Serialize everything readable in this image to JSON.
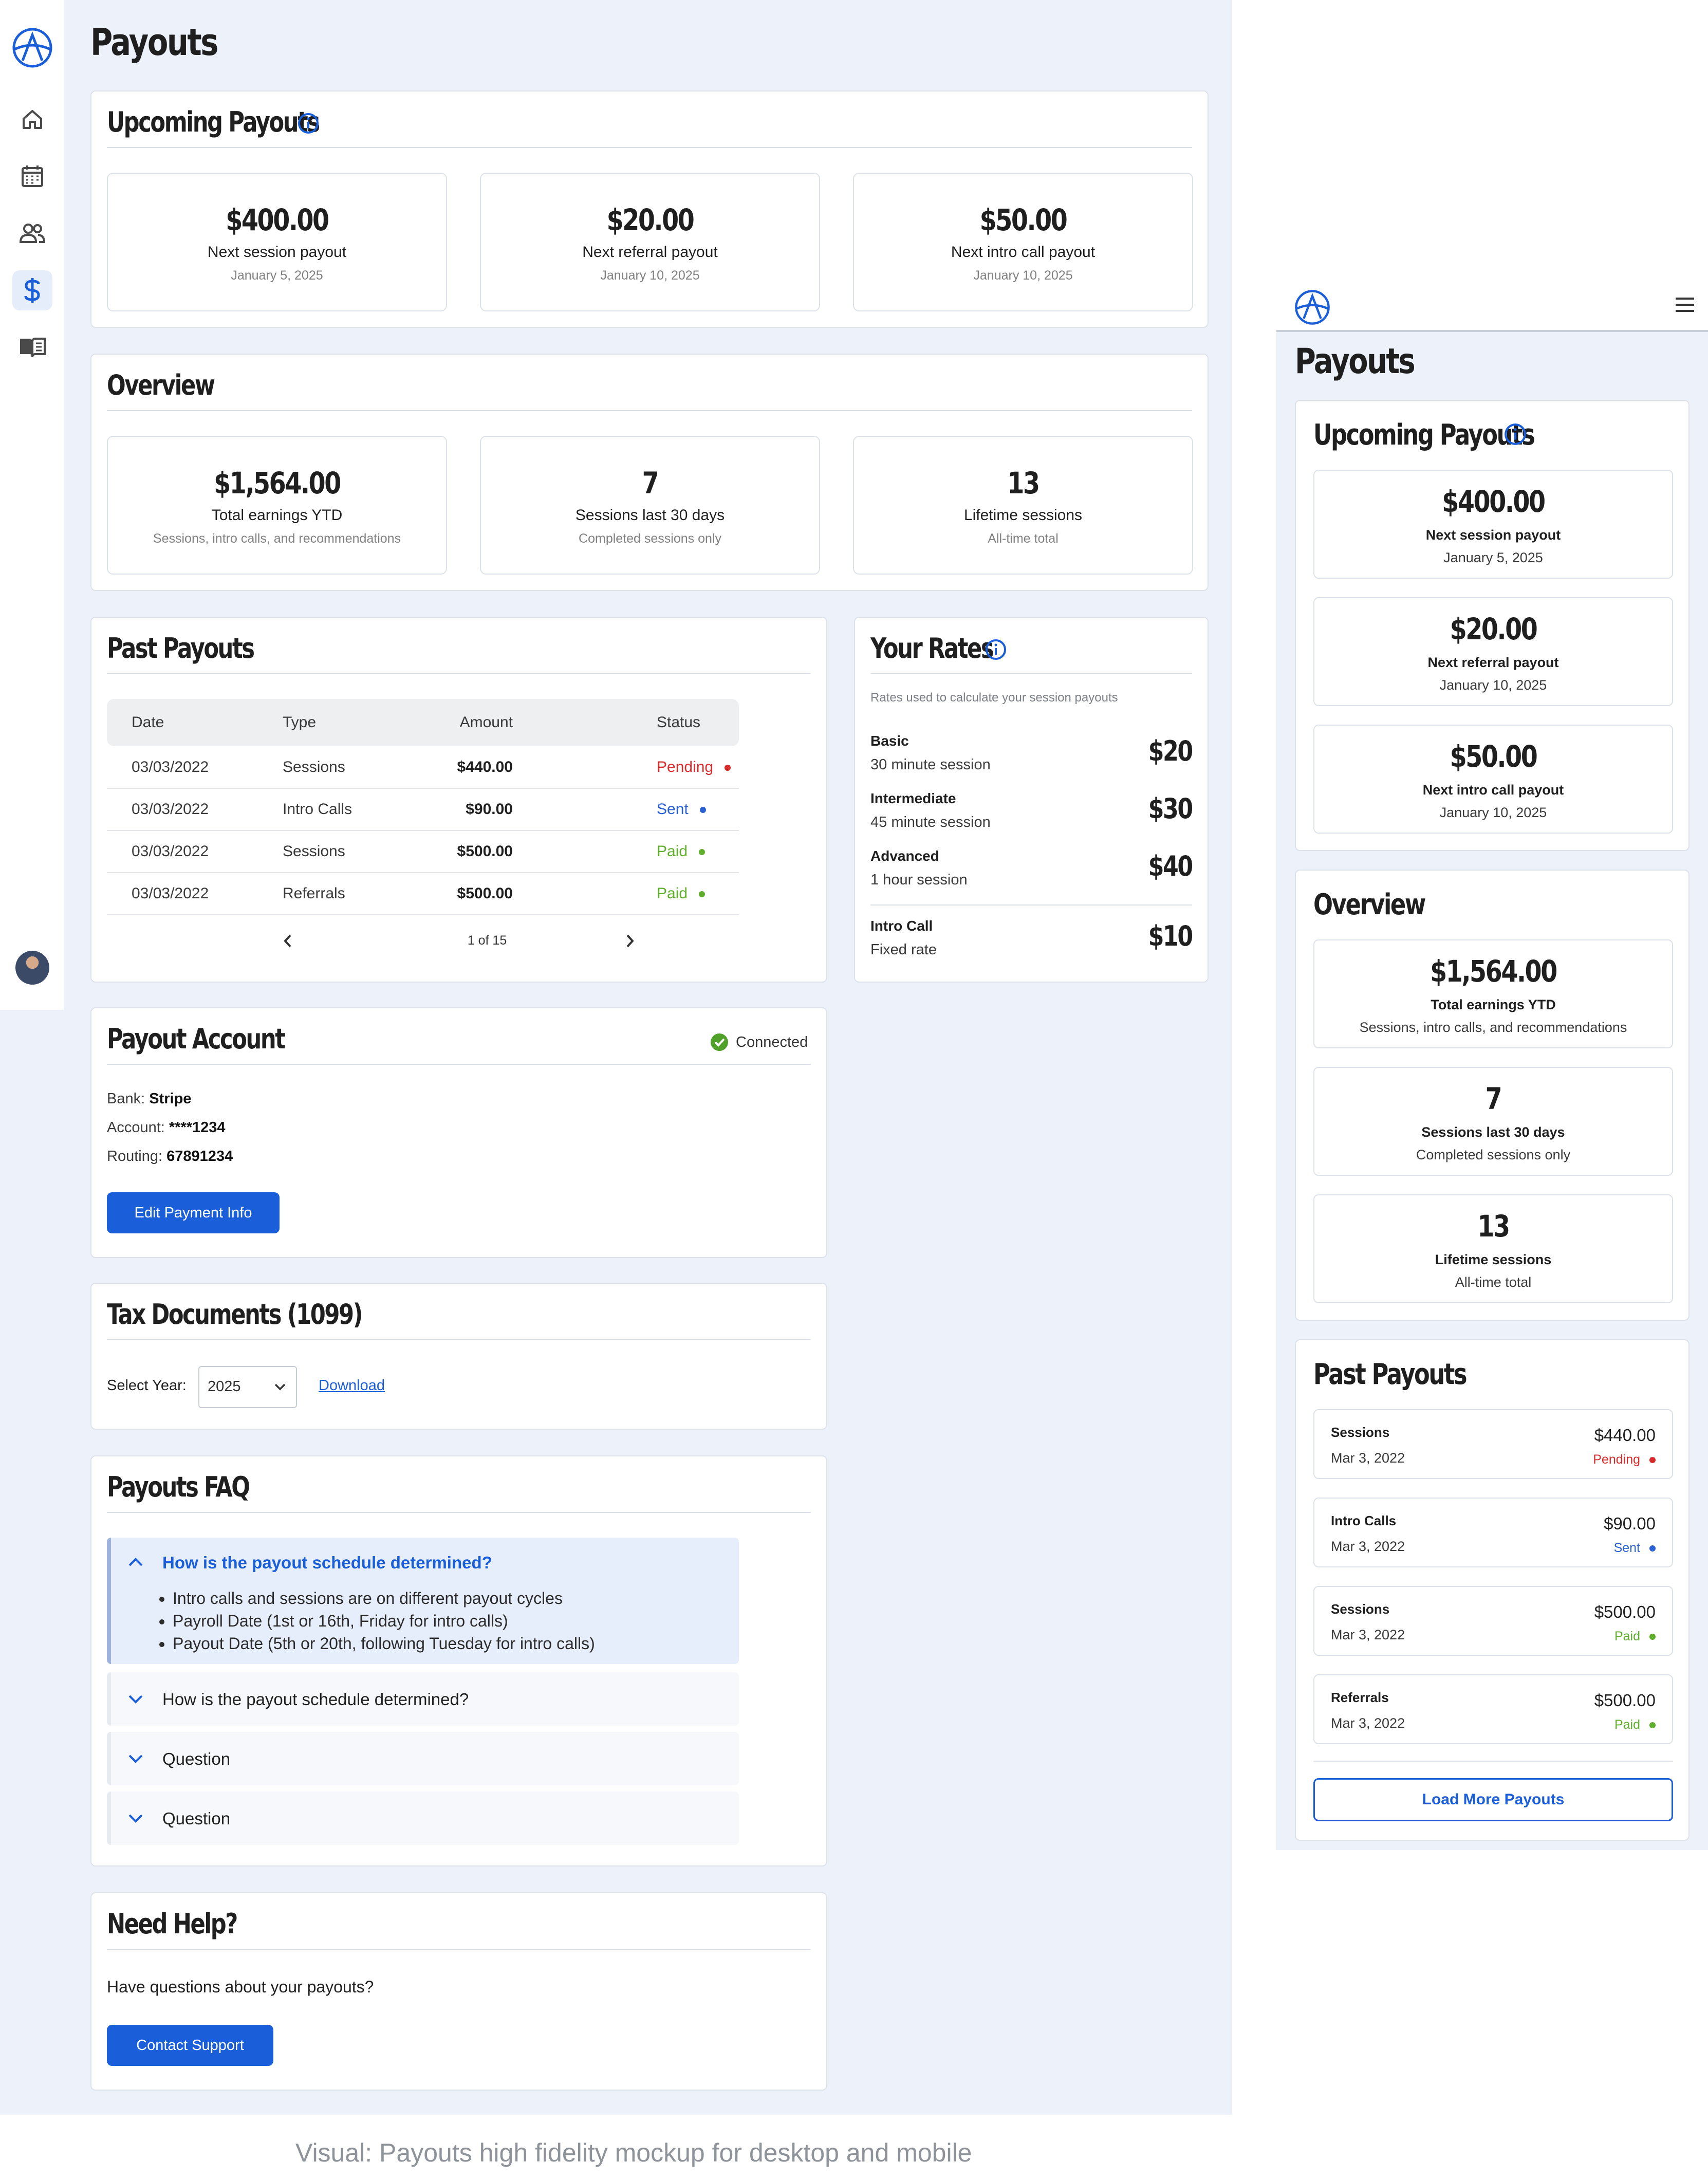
{
  "desktop": {
    "page_title": "Payouts",
    "nav": [
      "home-icon",
      "calendar-icon",
      "users-icon",
      "dollar-icon",
      "book-icon"
    ],
    "upcoming": {
      "title": "Upcoming Payouts",
      "cards": [
        {
          "value": "$400.00",
          "label": "Next session payout",
          "sub": "January 5, 2025"
        },
        {
          "value": "$20.00",
          "label": "Next referral payout",
          "sub": "January 10, 2025"
        },
        {
          "value": "$50.00",
          "label": "Next intro call payout",
          "sub": "January 10, 2025"
        }
      ]
    },
    "overview": {
      "title": "Overview",
      "cards": [
        {
          "value": "$1,564.00",
          "label": "Total earnings YTD",
          "sub": "Sessions, intro calls, and recommendations"
        },
        {
          "value": "7",
          "label": "Sessions last 30 days",
          "sub": "Completed sessions only"
        },
        {
          "value": "13",
          "label": "Lifetime sessions",
          "sub": "All-time total"
        }
      ]
    },
    "past": {
      "title": "Past Payouts",
      "columns": [
        "Date",
        "Type",
        "Amount",
        "Status"
      ],
      "rows": [
        {
          "date": "03/03/2022",
          "type": "Sessions",
          "amount": "$440.00",
          "status": "Pending"
        },
        {
          "date": "03/03/2022",
          "type": "Intro Calls",
          "amount": "$90.00",
          "status": "Sent"
        },
        {
          "date": "03/03/2022",
          "type": "Sessions",
          "amount": "$500.00",
          "status": "Paid"
        },
        {
          "date": "03/03/2022",
          "type": "Referrals",
          "amount": "$500.00",
          "status": "Paid"
        }
      ],
      "pagination": "1 of 15"
    },
    "rates": {
      "title": "Your Rates",
      "subtitle": "Rates used to calculate your session payouts",
      "items": [
        {
          "name": "Basic",
          "desc": "30 minute session",
          "price": "$20"
        },
        {
          "name": "Intermediate",
          "desc": "45 minute session",
          "price": "$30"
        },
        {
          "name": "Advanced",
          "desc": "1 hour session",
          "price": "$40"
        },
        {
          "name": "Intro Call",
          "desc": "Fixed rate",
          "price": "$10"
        }
      ]
    },
    "account": {
      "title": "Payout Account",
      "status": "Connected",
      "bank_label": "Bank:",
      "bank": "Stripe",
      "account_label": "Account:",
      "account": "****1234",
      "routing_label": "Routing:",
      "routing": "67891234",
      "edit_button": "Edit Payment Info"
    },
    "tax": {
      "title": "Tax Documents (1099)",
      "select_label": "Select Year:",
      "year": "2025",
      "download": "Download"
    },
    "faq": {
      "title": "Payouts FAQ",
      "items": [
        {
          "q": "How is the payout schedule determined?",
          "bullets": [
            "Intro calls and sessions are on different payout cycles",
            "Payroll Date (1st or 16th, Friday for intro calls)",
            "Payout Date (5th or 20th, following Tuesday for intro calls)"
          ]
        },
        {
          "q": "How is the payout schedule determined?"
        },
        {
          "q": "Question"
        },
        {
          "q": "Question"
        }
      ]
    },
    "help": {
      "title": "Need Help?",
      "text": "Have questions about your payouts?",
      "button": "Contact Support"
    }
  },
  "mobile": {
    "page_title": "Payouts",
    "upcoming": {
      "title": "Upcoming Payouts",
      "cards": [
        {
          "value": "$400.00",
          "label": "Next session payout",
          "sub": "January 5, 2025"
        },
        {
          "value": "$20.00",
          "label": "Next referral payout",
          "sub": "January 10, 2025"
        },
        {
          "value": "$50.00",
          "label": "Next intro call payout",
          "sub": "January 10, 2025"
        }
      ]
    },
    "overview": {
      "title": "Overview",
      "cards": [
        {
          "value": "$1,564.00",
          "label": "Total earnings YTD",
          "sub": "Sessions, intro calls, and recommendations"
        },
        {
          "value": "7",
          "label": "Sessions last 30 days",
          "sub": "Completed sessions only"
        },
        {
          "value": "13",
          "label": "Lifetime sessions",
          "sub": "All-time total"
        }
      ]
    },
    "past": {
      "title": "Past Payouts",
      "rows": [
        {
          "type": "Sessions",
          "date": "Mar 3, 2022",
          "amount": "$440.00",
          "status": "Pending"
        },
        {
          "type": "Intro Calls",
          "date": "Mar 3, 2022",
          "amount": "$90.00",
          "status": "Sent"
        },
        {
          "type": "Sessions",
          "date": "Mar 3, 2022",
          "amount": "$500.00",
          "status": "Paid"
        },
        {
          "type": "Referrals",
          "date": "Mar 3, 2022",
          "amount": "$500.00",
          "status": "Paid"
        }
      ],
      "load_more": "Load More Payouts"
    }
  },
  "colors": {
    "accent": "#1a5ed9",
    "pending": "#d92b2b",
    "sent": "#2a62d6",
    "paid": "#5fae2c",
    "background": "#ecf1fa"
  },
  "caption": "Visual: Payouts high fidelity mockup for desktop and mobile"
}
